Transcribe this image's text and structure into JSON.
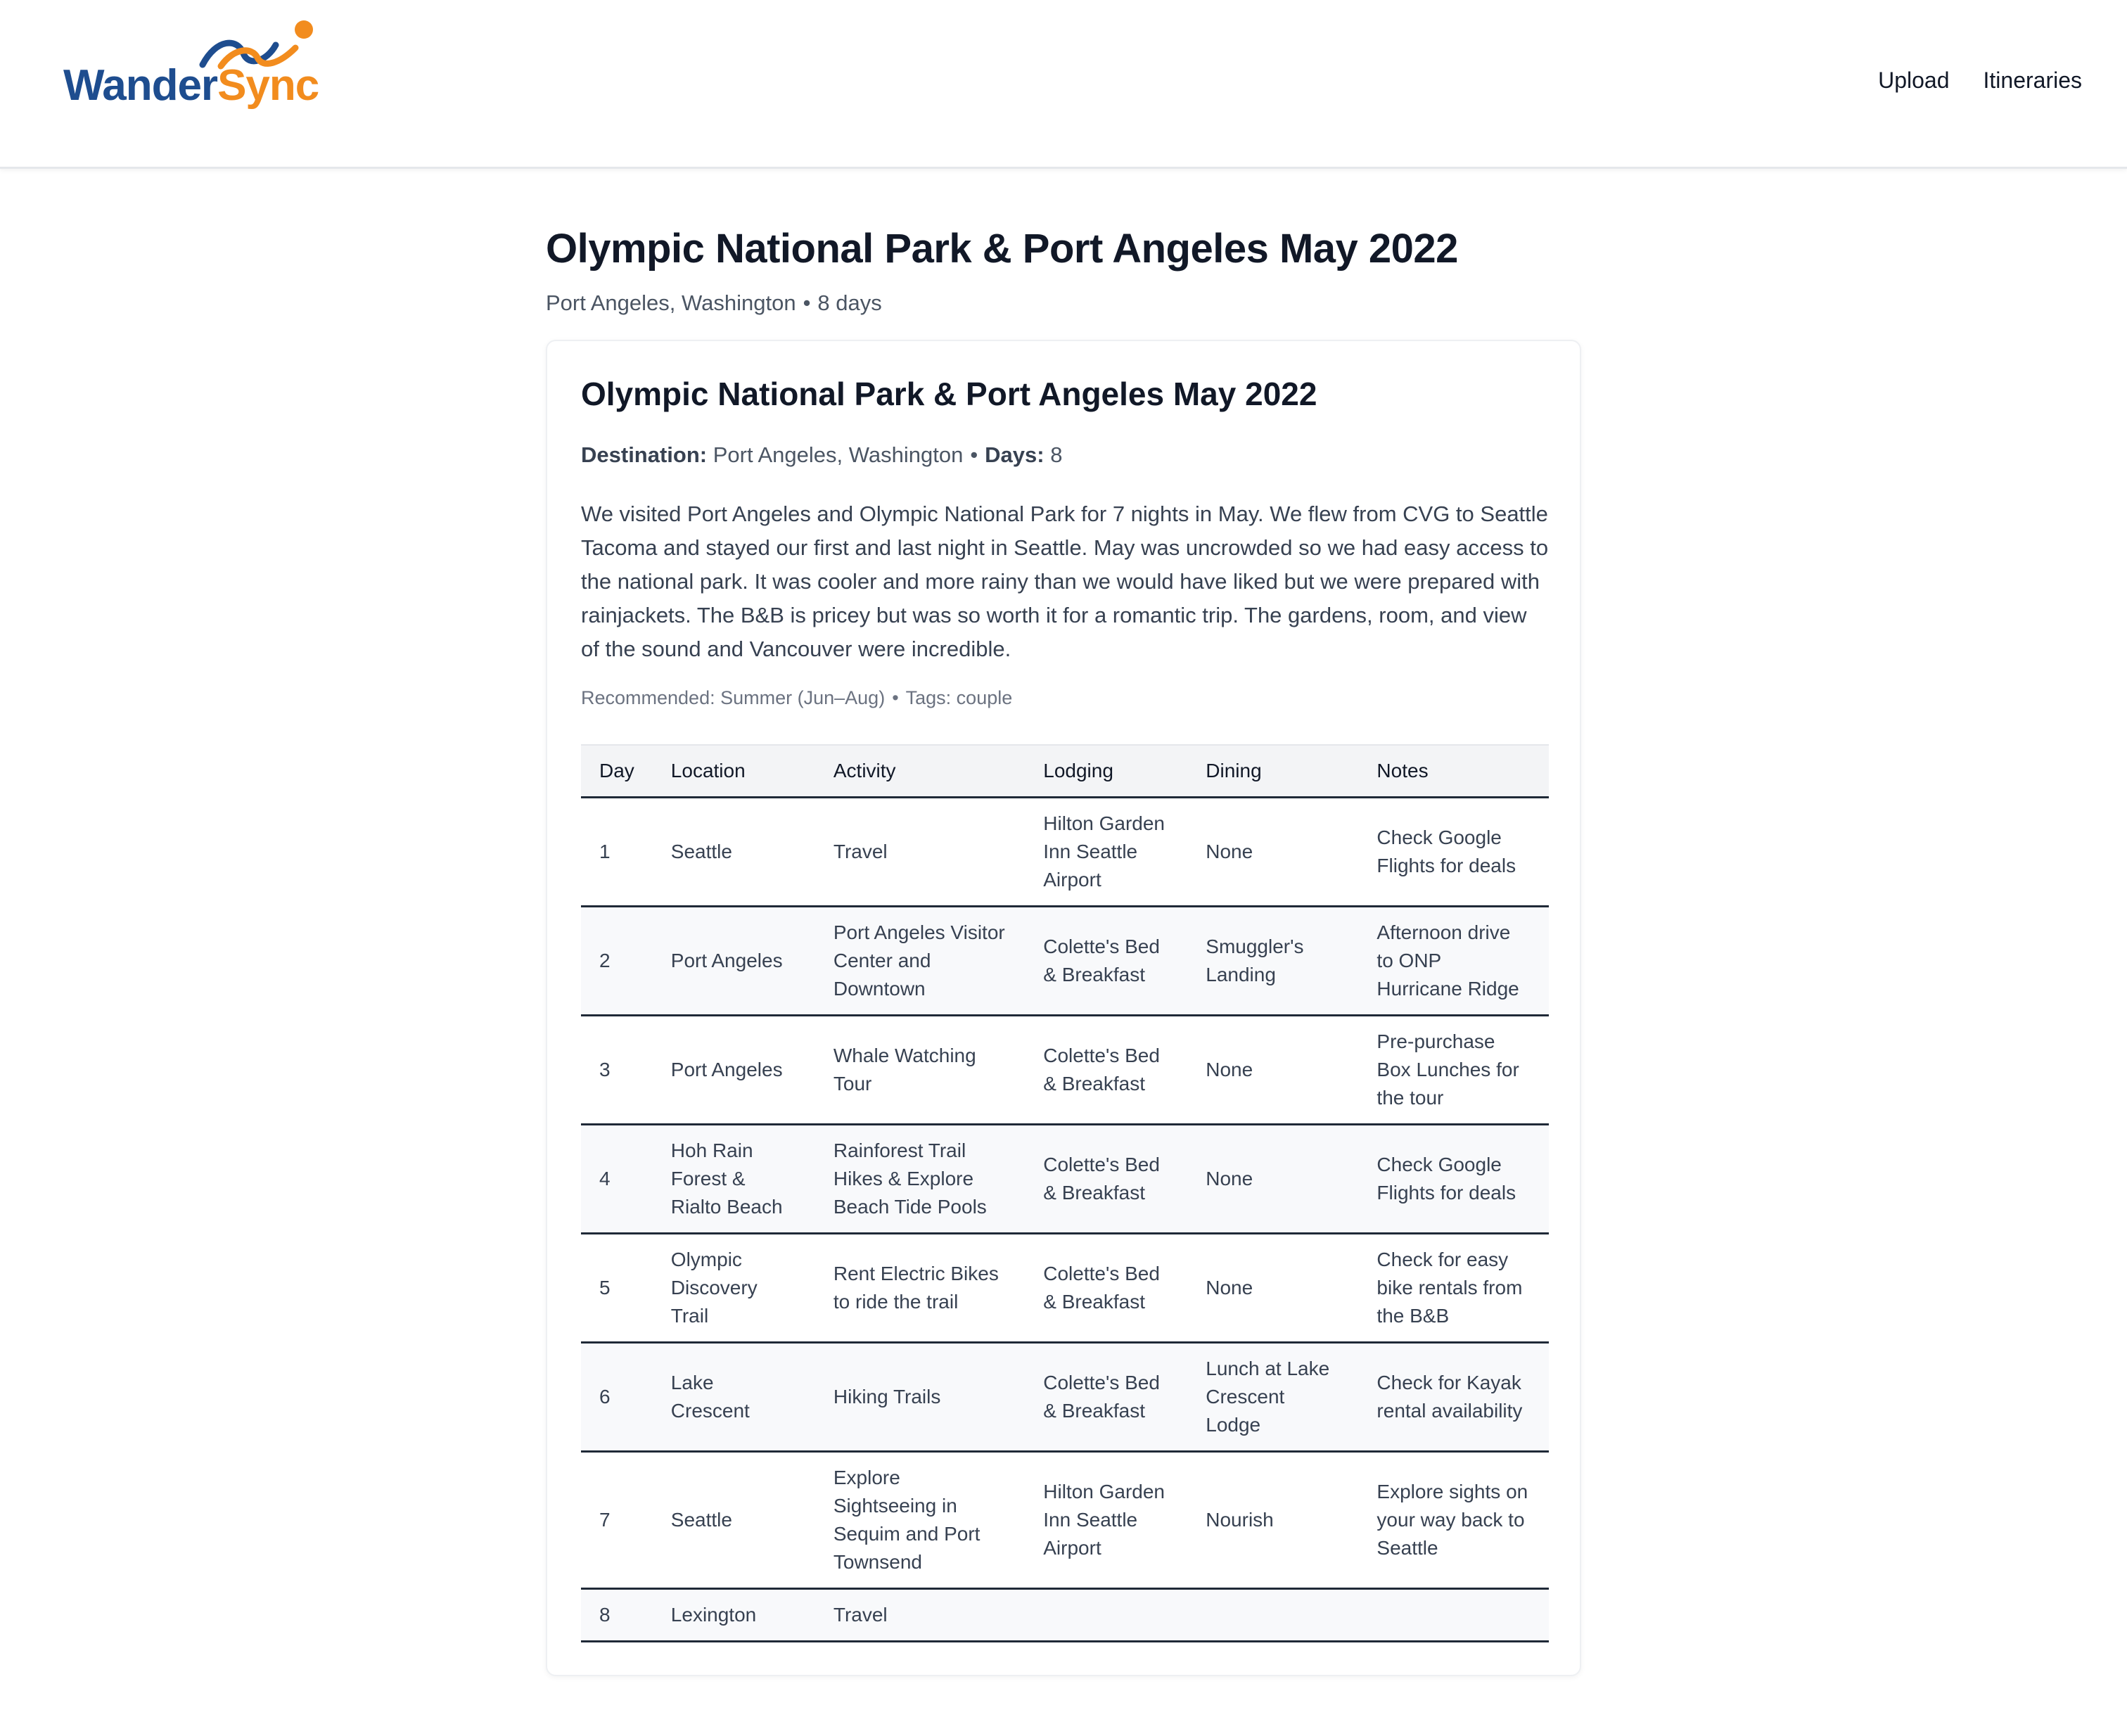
{
  "brand": {
    "name_part1": "Wander",
    "name_part2": "Sync",
    "accent": "#f28c1e",
    "primary": "#1e4d8f"
  },
  "nav": {
    "items": [
      {
        "label": "Upload"
      },
      {
        "label": "Itineraries"
      }
    ]
  },
  "page": {
    "title": "Olympic National Park & Port Angeles May 2022",
    "location": "Port Angeles, Washington",
    "duration": "8 days"
  },
  "card": {
    "title": "Olympic National Park & Port Angeles May 2022",
    "destination_label": "Destination:",
    "destination": "Port Angeles, Washington",
    "days_label": "Days:",
    "days": "8",
    "description": "We visited Port Angeles and Olympic National Park for 7 nights in May. We flew from CVG to Seattle Tacoma and stayed our first and last night in Seattle. May was uncrowded so we had easy access to the national park. It was cooler and more rainy than we would have liked but we were prepared with rainjackets. The B&B is pricey but was so worth it for a romantic trip. The gardens, room, and view of the sound and Vancouver were incredible.",
    "recommended": "Recommended: Summer (Jun–Aug)",
    "tags": "Tags: couple"
  },
  "table": {
    "headers": [
      "Day",
      "Location",
      "Activity",
      "Lodging",
      "Dining",
      "Notes"
    ],
    "rows": [
      [
        "1",
        "Seattle",
        "Travel",
        "Hilton Garden Inn Seattle Airport",
        "None",
        "Check Google Flights for deals"
      ],
      [
        "2",
        "Port Angeles",
        "Port Angeles Visitor Center and Downtown",
        "Colette's Bed & Breakfast",
        "Smuggler's Landing",
        "Afternoon drive to ONP Hurricane Ridge"
      ],
      [
        "3",
        "Port Angeles",
        "Whale Watching Tour",
        "Colette's Bed & Breakfast",
        "None",
        "Pre-purchase Box Lunches for the tour"
      ],
      [
        "4",
        "Hoh Rain Forest & Rialto Beach",
        "Rainforest Trail Hikes & Explore Beach Tide Pools",
        "Colette's Bed & Breakfast",
        "None",
        "Check Google Flights for deals"
      ],
      [
        "5",
        "Olympic Discovery Trail",
        "Rent Electric Bikes to ride the trail",
        "Colette's Bed & Breakfast",
        "None",
        "Check for easy bike rentals from the B&B"
      ],
      [
        "6",
        "Lake Crescent",
        "Hiking Trails",
        "Colette's Bed & Breakfast",
        "Lunch at Lake Crescent Lodge",
        "Check for Kayak rental availability"
      ],
      [
        "7",
        "Seattle",
        "Explore Sightseeing in Sequim and Port Townsend",
        "Hilton Garden Inn Seattle Airport",
        "Nourish",
        "Explore sights on your way back to Seattle"
      ],
      [
        "8",
        "Lexington",
        "Travel",
        "",
        "",
        ""
      ]
    ]
  }
}
